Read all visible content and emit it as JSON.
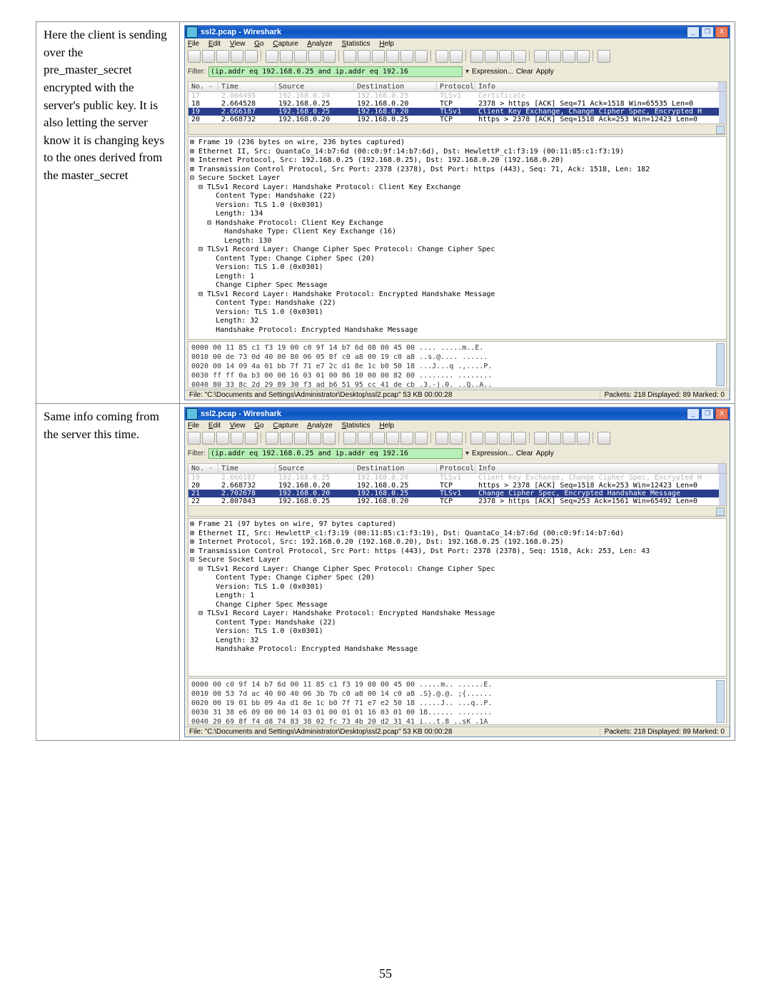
{
  "page_number": "55",
  "sidebar": {
    "top": "Here the client is sending over the pre_master_secret encrypted with the server's public key. It is also letting the server know it is changing keys to the ones derived from the master_secret",
    "bottom": "Same info coming from the server this time."
  },
  "wireshark_common": {
    "title": "ssl2.pcap - Wireshark",
    "menus": [
      "File",
      "Edit",
      "View",
      "Go",
      "Capture",
      "Analyze",
      "Statistics",
      "Help"
    ],
    "filter_label": "Filter:",
    "filter_value": "(ip.addr eq 192.168.0.25 and ip.addr eq 192.16",
    "filter_links": [
      "Expression...",
      "Clear",
      "Apply"
    ],
    "column_headers": [
      "No. -",
      "Time",
      "Source",
      "Destination",
      "Protocol",
      "Info"
    ],
    "status_file": "File: \"C:\\Documents and Settings\\Administrator\\Desktop\\ssl2.pcap\" 53 KB 00:00:28",
    "status_pkts": "Packets: 218 Displayed: 89 Marked: 0"
  },
  "top_packets": [
    {
      "no": "17",
      "time": "2.004495",
      "src": "192.168.0.20",
      "dst": "192.168.0.25",
      "proto": "TLSv1",
      "info": "Certificate",
      "cls": "tls faded"
    },
    {
      "no": "18",
      "time": "2.664528",
      "src": "192.168.0.25",
      "dst": "192.168.0.20",
      "proto": "TCP",
      "info": "2378 > https [ACK] Seq=71 Ack=1518 Win=65535 Len=0",
      "cls": "tcp"
    },
    {
      "no": "19",
      "time": "2.666187",
      "src": "192.168.0.25",
      "dst": "192.168.0.20",
      "proto": "TLSv1",
      "info": "Client Key Exchange, Change Cipher Spec, Encrypted H",
      "cls": "sel"
    },
    {
      "no": "20",
      "time": "2.668732",
      "src": "192.168.0.20",
      "dst": "192.168.0.25",
      "proto": "TCP",
      "info": "https > 2378 [ACK] Seq=1518 Ack=253 Win=12423 Len=0",
      "cls": "tcp"
    }
  ],
  "top_tree": [
    "⊞ Frame 19 (236 bytes on wire, 236 bytes captured)",
    "⊞ Ethernet II, Src: QuantaCo_14:b7:6d (00:c0:9f:14:b7:6d), Dst: HewlettP_c1:f3:19 (00:11:85:c1:f3:19)",
    "⊞ Internet Protocol, Src: 192.168.0.25 (192.168.0.25), Dst: 192.168.0.20 (192.168.0.20)",
    "⊞ Transmission Control Protocol, Src Port: 2378 (2378), Dst Port: https (443), Seq: 71, Ack: 1518, Len: 182",
    "⊟ Secure Socket Layer",
    "  ⊟ TLSv1 Record Layer: Handshake Protocol: Client Key Exchange",
    "      Content Type: Handshake (22)",
    "      Version: TLS 1.0 (0x0301)",
    "      Length: 134",
    "    ⊟ Handshake Protocol: Client Key Exchange",
    "        Handshake Type: Client Key Exchange (16)",
    "        Length: 130",
    "  ⊟ TLSv1 Record Layer: Change Cipher Spec Protocol: Change Cipher Spec",
    "      Content Type: Change Cipher Spec (20)",
    "      Version: TLS 1.0 (0x0301)",
    "      Length: 1",
    "      Change Cipher Spec Message",
    "  ⊟ TLSv1 Record Layer: Handshake Protocol: Encrypted Handshake Message",
    "      Content Type: Handshake (22)",
    "      Version: TLS 1.0 (0x0301)",
    "      Length: 32",
    "      Handshake Protocol: Encrypted Handshake Message"
  ],
  "top_bytes": [
    "0000  00 11 85 c1 f3 19 00 c0  9f 14 b7 6d 08 00 45 00   .... .....m..E.",
    "0010  00 de 73 0d 40 00 80 06  05 8f c0 a8 00 19 c0 a8   ..s.@.... ......",
    "0020  00 14 09 4a 01 bb 7f 71  e7 2c d1 8e 1c b0 50 18   ...J...q .,....P.",
    "0030  ff ff 0a b3 00 00 16 03  01 00 86 10 00 00 82 00   ........ ........",
    "0040  80 33 8c 2d 29 89 30 f3  ad b6 51 95 cc 41 de cb   .3.-).0. ..Q..A.."
  ],
  "bottom_packets": [
    {
      "no": "19",
      "time": "2.666187",
      "src": "192.168.0.25",
      "dst": "192.168.0.20",
      "proto": "TLSv1",
      "info": "Client Key Exchange, Change Cipher Spec, Encrypted H",
      "cls": "tls faded"
    },
    {
      "no": "20",
      "time": "2.668732",
      "src": "192.168.0.20",
      "dst": "192.168.0.25",
      "proto": "TCP",
      "info": "https > 2378 [ACK] Seq=1518 Ack=253 Win=12423 Len=0",
      "cls": "tcp"
    },
    {
      "no": "21",
      "time": "2.702678",
      "src": "192.168.0.20",
      "dst": "192.168.0.25",
      "proto": "TLSv1",
      "info": "Change Cipher Spec, Encrypted Handshake Message",
      "cls": "sel"
    },
    {
      "no": "22",
      "time": "2.807843",
      "src": "192.168.0.25",
      "dst": "192.168.0.20",
      "proto": "TCP",
      "info": "2378 > https [ACK] Seq=253 Ack=1561 Win=65492 Len=0",
      "cls": "tcp"
    }
  ],
  "bottom_tree": [
    "⊞ Frame 21 (97 bytes on wire, 97 bytes captured)",
    "⊞ Ethernet II, Src: HewlettP_c1:f3:19 (00:11:85:c1:f3:19), Dst: QuantaCo_14:b7:6d (00:c0:9f:14:b7:6d)",
    "⊞ Internet Protocol, Src: 192.168.0.20 (192.168.0.20), Dst: 192.168.0.25 (192.168.0.25)",
    "⊞ Transmission Control Protocol, Src Port: https (443), Dst Port: 2378 (2378), Seq: 1518, Ack: 253, Len: 43",
    "⊟ Secure Socket Layer",
    "  ⊟ TLSv1 Record Layer: Change Cipher Spec Protocol: Change Cipher Spec",
    "      Content Type: Change Cipher Spec (20)",
    "      Version: TLS 1.0 (0x0301)",
    "      Length: 1",
    "      Change Cipher Spec Message",
    "  ⊟ TLSv1 Record Layer: Handshake Protocol: Encrypted Handshake Message",
    "      Content Type: Handshake (22)",
    "      Version: TLS 1.0 (0x0301)",
    "      Length: 32",
    "      Handshake Protocol: Encrypted Handshake Message"
  ],
  "bottom_bytes": [
    "0000  00 c0 9f 14 b7 6d 00 11  85 c1 f3 19 08 00 45 00   .....m.. ......E.",
    "0010  00 53 7d ac 40 00 40 06  3b 7b c0 a8 00 14 c0 a8   .S}.@.@. ;{......",
    "0020  00 19 01 bb 09 4a d1 8e  1c b0 7f 71 e7 e2 50 18   .....J.. ...q..P.",
    "0030  31 38 e6 09 00 00 14 03  01 00 01 01 16 03 01 00   18...... ........",
    "0040  20 69 8f f4 d8 74 83 38  02 fc 73 4b 20 d2 31 41    i...t.8 ..sK .1A"
  ]
}
